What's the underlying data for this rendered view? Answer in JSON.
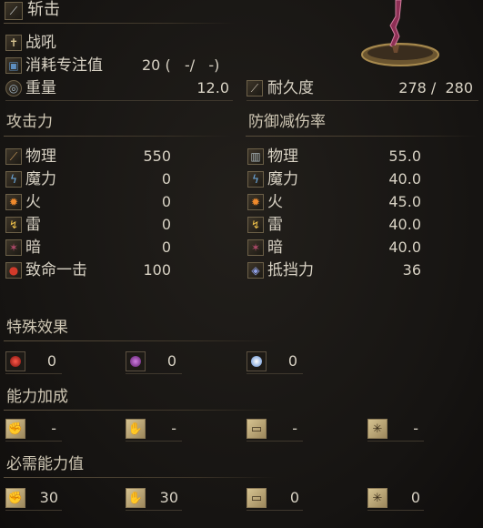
{
  "header": {
    "title": "斩击"
  },
  "weapon_info": {
    "skill": "战吼",
    "fp_cost_label": "消耗专注值",
    "fp_cost_value": "20 (   -/   -)",
    "weight_label": "重量",
    "weight_value": "12.0",
    "durability_label": "耐久度",
    "durability_value": "278 /  280"
  },
  "attack": {
    "title": "攻击力",
    "rows": [
      {
        "label": "物理",
        "value": "550",
        "icon": "sword-icon"
      },
      {
        "label": "魔力",
        "value": "0",
        "icon": "magic-icon"
      },
      {
        "label": "火",
        "value": "0",
        "icon": "fire-icon"
      },
      {
        "label": "雷",
        "value": "0",
        "icon": "lightning-icon"
      },
      {
        "label": "暗",
        "value": "0",
        "icon": "dark-icon"
      },
      {
        "label": "致命一击",
        "value": "100",
        "icon": "critical-icon"
      }
    ]
  },
  "defense": {
    "title": "防御减伤率",
    "rows": [
      {
        "label": "物理",
        "value": "55.0"
      },
      {
        "label": "魔力",
        "value": "40.0"
      },
      {
        "label": "火",
        "value": "45.0"
      },
      {
        "label": "雷",
        "value": "40.0"
      },
      {
        "label": "暗",
        "value": "40.0"
      },
      {
        "label": "抵挡力",
        "value": "36"
      }
    ]
  },
  "special": {
    "title": "特殊效果",
    "items": [
      {
        "icon": "bleed-icon",
        "value": "0"
      },
      {
        "icon": "poison-icon",
        "value": "0"
      },
      {
        "icon": "frost-icon",
        "value": "0"
      }
    ]
  },
  "scaling": {
    "title": "能力加成",
    "items": [
      {
        "icon": "strength-icon",
        "value": "-"
      },
      {
        "icon": "dexterity-icon",
        "value": "-"
      },
      {
        "icon": "intelligence-icon",
        "value": "-"
      },
      {
        "icon": "faith-icon",
        "value": "-"
      }
    ]
  },
  "requirements": {
    "title": "必需能力值",
    "items": [
      {
        "icon": "strength-icon",
        "value": "30"
      },
      {
        "icon": "dexterity-icon",
        "value": "30"
      },
      {
        "icon": "intelligence-icon",
        "value": "0"
      },
      {
        "icon": "faith-icon",
        "value": "0"
      }
    ]
  },
  "colors": {
    "accent": "#d6c391",
    "text": "#d8d2c4",
    "background": "#161412"
  }
}
